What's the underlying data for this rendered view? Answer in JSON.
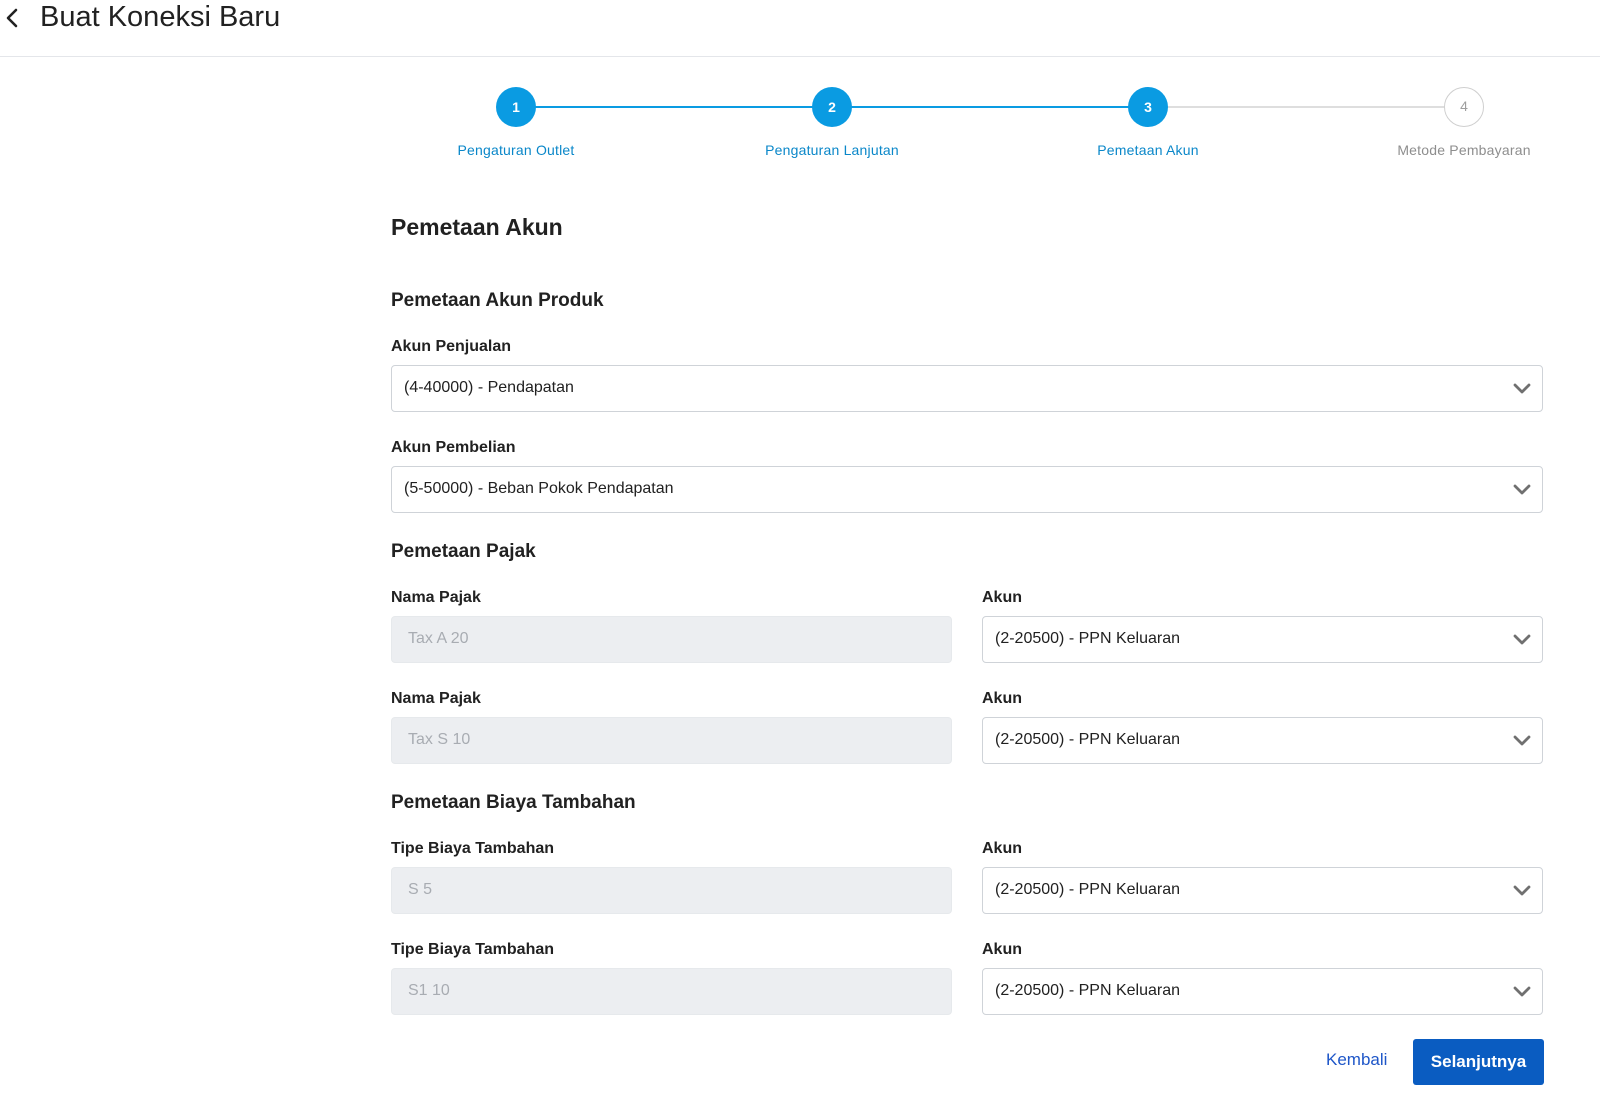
{
  "header": {
    "title": "Buat Koneksi Baru",
    "back_icon": "chevron-left-icon"
  },
  "stepper": {
    "steps": [
      {
        "number": "1",
        "label": "Pengaturan Outlet",
        "state": "complete"
      },
      {
        "number": "2",
        "label": "Pengaturan Lanjutan",
        "state": "complete"
      },
      {
        "number": "3",
        "label": "Pemetaan Akun",
        "state": "current"
      },
      {
        "number": "4",
        "label": "Metode Pembayaran",
        "state": "upcoming"
      }
    ],
    "active_color": "#0a9be2",
    "inactive_color": "#cfcfcf"
  },
  "form": {
    "title": "Pemetaan Akun",
    "product_section": {
      "title": "Pemetaan Akun Produk",
      "sales_label": "Akun Penjualan",
      "sales_value": "(4-40000) - Pendapatan",
      "purchase_label": "Akun Pembelian",
      "purchase_value": "(5-50000) - Beban Pokok Pendapatan"
    },
    "tax_section": {
      "title": "Pemetaan Pajak",
      "rows": [
        {
          "name_label": "Nama Pajak",
          "name_value": "Tax A 20",
          "account_label": "Akun",
          "account_value": "(2-20500) - PPN Keluaran"
        },
        {
          "name_label": "Nama Pajak",
          "name_value": "Tax S 10",
          "account_label": "Akun",
          "account_value": "(2-20500) - PPN Keluaran"
        }
      ]
    },
    "fee_section": {
      "title": "Pemetaan Biaya Tambahan",
      "rows": [
        {
          "type_label": "Tipe Biaya Tambahan",
          "type_value": "S 5",
          "account_label": "Akun",
          "account_value": "(2-20500) - PPN Keluaran"
        },
        {
          "type_label": "Tipe Biaya Tambahan",
          "type_value": "S1 10",
          "account_label": "Akun",
          "account_value": "(2-20500) - PPN Keluaran"
        }
      ]
    }
  },
  "actions": {
    "back_label": "Kembali",
    "next_label": "Selanjutnya",
    "primary_color": "#0a5cc1"
  }
}
